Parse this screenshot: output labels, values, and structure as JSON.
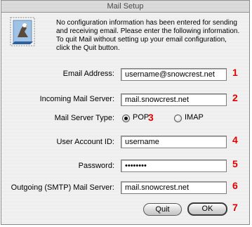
{
  "window": {
    "title": "Mail Setup"
  },
  "intro": {
    "lines": [
      "No configuration information has been entered for sending",
      "and receiving email. Please enter the following information.",
      "To quit Mail without setting up your email configuration,",
      "click the Quit button."
    ]
  },
  "form": {
    "email_label": "Email Address:",
    "email_value": "username@snowcrest.net",
    "incoming_label": "Incoming Mail Server:",
    "incoming_value": "mail.snowcrest.net",
    "server_type_label": "Mail Server Type:",
    "pop_label": "POP",
    "imap_label": "IMAP",
    "selected_type": "POP",
    "user_label": "User Account ID:",
    "user_value": "username",
    "password_label": "Password:",
    "password_value": "••••••••",
    "outgoing_label": "Outgoing (SMTP) Mail Server:",
    "outgoing_value": "mail.snowcrest.net"
  },
  "buttons": {
    "quit_label": "Quit",
    "ok_label": "OK"
  },
  "annotations": [
    "1",
    "2",
    "3",
    "4",
    "5",
    "6",
    "7"
  ],
  "colors": {
    "annotation": "#e00000"
  },
  "icons": {
    "app_icon": "mail-stamp-eagle-icon"
  }
}
